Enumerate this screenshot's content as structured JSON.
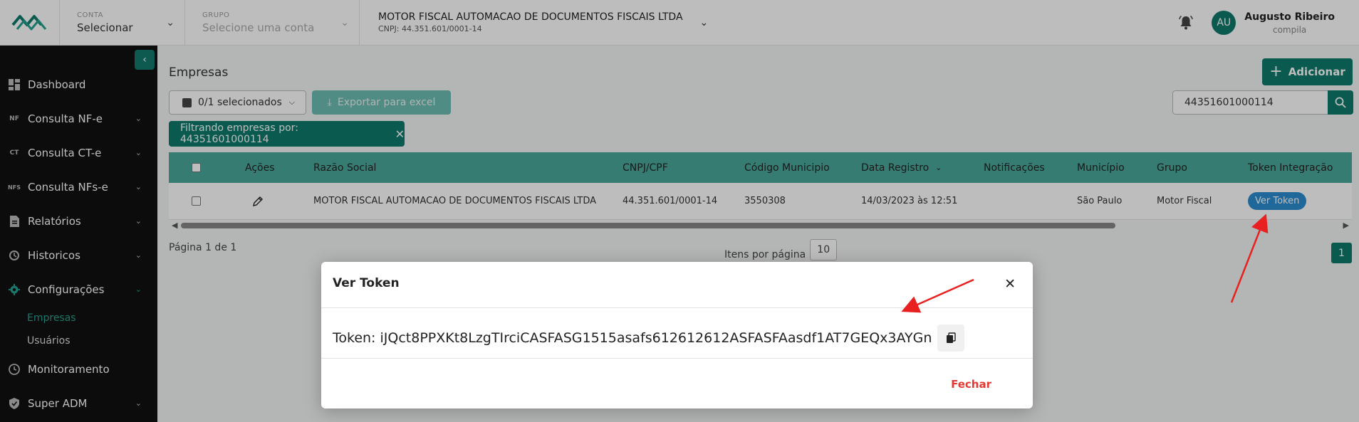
{
  "header": {
    "conta_label": "CONTA",
    "conta_value": "Selecionar",
    "grupo_label": "GRUPO",
    "grupo_placeholder": "Selecione uma conta",
    "company_name": "MOTOR FISCAL AUTOMACAO DE DOCUMENTOS FISCAIS LTDA",
    "company_cnpj": "CNPJ: 44.351.601/0001-14",
    "avatar_initials": "AU",
    "user_name": "Augusto Ribeiro",
    "user_role": "compila"
  },
  "sidebar": {
    "items": [
      {
        "label": "Dashboard",
        "icon": "dashboard-icon"
      },
      {
        "label": "Consulta NF-e",
        "icon": "nf-icon",
        "icon_text": "NF"
      },
      {
        "label": "Consulta CT-e",
        "icon": "ct-icon",
        "icon_text": "CT"
      },
      {
        "label": "Consulta NFs-e",
        "icon": "nfs-icon",
        "icon_text": "NFS"
      },
      {
        "label": "Relatórios",
        "icon": "document-icon"
      },
      {
        "label": "Historicos",
        "icon": "history-icon"
      },
      {
        "label": "Configurações",
        "icon": "gear-icon"
      },
      {
        "label": "Monitoramento",
        "icon": "clock-icon"
      },
      {
        "label": "Super ADM",
        "icon": "shield-icon"
      }
    ],
    "sub_items": [
      "Empresas",
      "Usuários"
    ]
  },
  "main": {
    "title": "Empresas",
    "add_label": "Adicionar",
    "selection_label": "0/1 selecionados",
    "export_label": "Exportar para excel",
    "search_value": "44351601000114",
    "filter_chip": "Filtrando empresas por: 44351601000114",
    "columns": [
      "Ações",
      "Razão Social",
      "CNPJ/CPF",
      "Código Municipio",
      "Data Registro",
      "Notificações",
      "Município",
      "Grupo",
      "Token Integração"
    ],
    "row": {
      "razao_social": "MOTOR FISCAL AUTOMACAO DE DOCUMENTOS FISCAIS LTDA",
      "cnpj": "44.351.601/0001-14",
      "codigo_municipio": "3550308",
      "data_registro": "14/03/2023 às 12:51",
      "notificacoes": "",
      "municipio": "São Paulo",
      "grupo": "Motor Fiscal",
      "token_button": "Ver Token"
    },
    "pagination_text": "Página 1 de 1",
    "items_per_page_label": "Itens por página",
    "items_per_page_value": "10",
    "current_page": "1"
  },
  "modal": {
    "title": "Ver Token",
    "token_text": "Token: iJQct8PPXKt8LzgTIrciCASFASG1515asafs612612612ASFASFAasdf1AT7GEQx3AYGn",
    "close_label": "Fechar"
  },
  "colors": {
    "brand": "#0f7a6c",
    "table_header": "#4ba89a",
    "token_button": "#2c8dd0",
    "close_text": "#e53935",
    "annotation_arrow": "#e82020"
  }
}
